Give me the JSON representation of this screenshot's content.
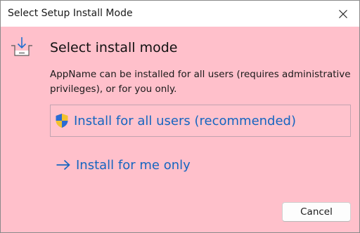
{
  "window": {
    "title": "Select Setup Install Mode",
    "close_icon": "close-icon"
  },
  "header": {
    "icon": "install-tray-icon",
    "heading": "Select install mode",
    "description": "AppName can be installed for all users (requires administrative privileges), or for you only."
  },
  "options": [
    {
      "icon": "uac-shield-icon",
      "label": "Install for all users (recommended)"
    },
    {
      "icon": "arrow-right-icon",
      "label": "Install for me only"
    }
  ],
  "footer": {
    "cancel_label": "Cancel"
  },
  "colors": {
    "background": "#ffc0cb",
    "titlebar": "#ffffff",
    "link": "#1565c0",
    "option_border": "#c2a3b0"
  }
}
